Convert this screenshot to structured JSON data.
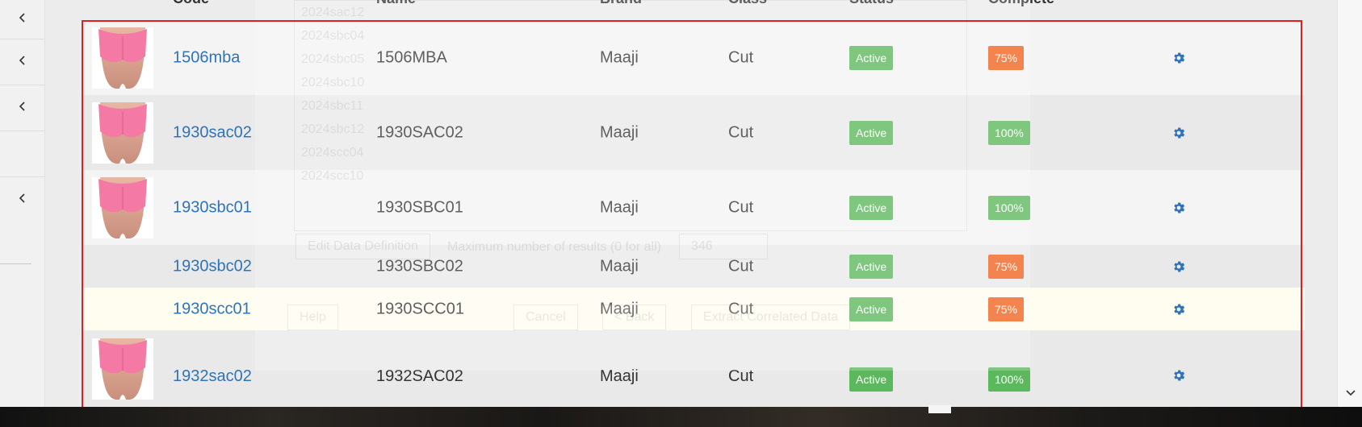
{
  "table": {
    "headers": [
      "Code",
      "Name",
      "Brand",
      "Class",
      "Status",
      "Complete"
    ],
    "rows": [
      {
        "code": "1506mba",
        "name": "1506MBA",
        "brand": "Maaji",
        "class": "Cut",
        "status": "Active",
        "complete": "75%",
        "has_image": true
      },
      {
        "code": "1930sac02",
        "name": "1930SAC02",
        "brand": "Maaji",
        "class": "Cut",
        "status": "Active",
        "complete": "100%",
        "has_image": true
      },
      {
        "code": "1930sbc01",
        "name": "1930SBC01",
        "brand": "Maaji",
        "class": "Cut",
        "status": "Active",
        "complete": "100%",
        "has_image": true
      },
      {
        "code": "1930sbc02",
        "name": "1930SBC02",
        "brand": "Maaji",
        "class": "Cut",
        "status": "Active",
        "complete": "75%",
        "has_image": false
      },
      {
        "code": "1930scc01",
        "name": "1930SCC01",
        "brand": "Maaji",
        "class": "Cut",
        "status": "Active",
        "complete": "75%",
        "has_image": false
      },
      {
        "code": "1932sac02",
        "name": "1932SAC02",
        "brand": "Maaji",
        "class": "Cut",
        "status": "Active",
        "complete": "100%",
        "has_image": true
      }
    ]
  },
  "background_dialog": {
    "list_items": [
      "2024sac12",
      "2024sbc04",
      "2024sbc05",
      "2024sbc10",
      "2024sbc11",
      "2024sbc12",
      "2024scc04",
      "2024scc10"
    ],
    "edit_button": "Edit Data Definition",
    "max_results_label": "Maximum number of results (0 for all)",
    "max_results_value": "346",
    "buttons": [
      "Help",
      "Cancel",
      "< Back",
      "Extract Correlated Data"
    ]
  },
  "colors": {
    "status_active": "#5cb85c",
    "complete_75": "#f0621d",
    "complete_100": "#5cb85c",
    "link": "#2f73b8",
    "gear": "#2f73b8",
    "selection": "#e02020"
  },
  "icons": {
    "sidebar": [
      "chevron-left-icon",
      "chevron-left-icon",
      "chevron-left-icon",
      "chevron-left-icon"
    ],
    "row_action": "gear-icon",
    "scroll": "chevron-down-icon"
  }
}
